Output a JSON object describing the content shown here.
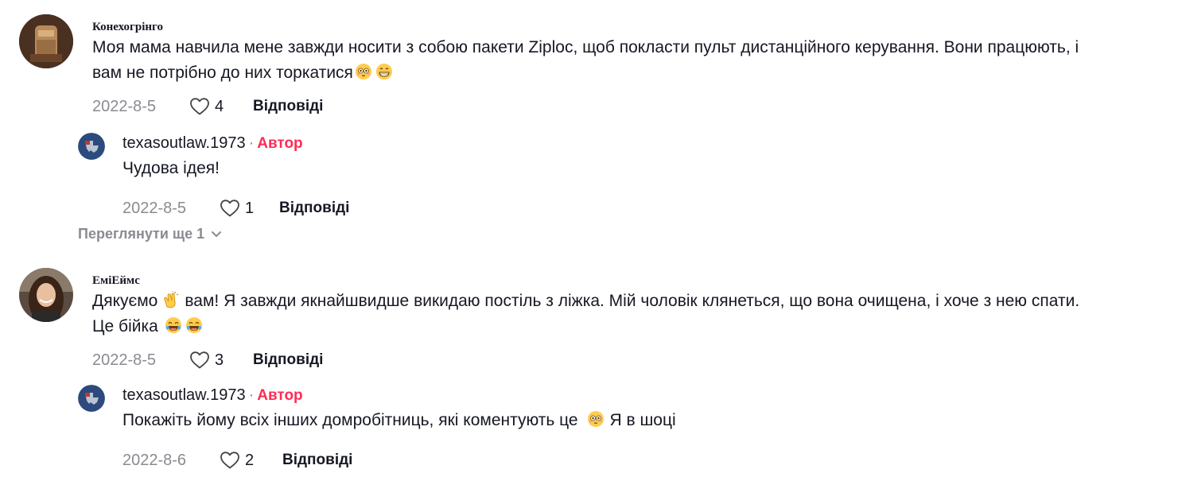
{
  "comments": [
    {
      "username": "Конехогрінго",
      "text_parts": [
        "Моя мама навчила мене завжди носити з собою пакети Ziploc, щоб покласти пульт дистанційного керування. Вони працюють, і",
        "вам не потрібно до них торкатися"
      ],
      "emojis": [
        "flushed-face-emoji",
        "grinning-face-emoji"
      ],
      "date": "2022-8-5",
      "likes": "4",
      "reply_label": "Відповіді",
      "reply": {
        "username": "texasoutlaw.1973",
        "separator": "·",
        "badge": "Автор",
        "text": "Чудова ідея!",
        "date": "2022-8-5",
        "likes": "1",
        "reply_label": "Відповіді"
      },
      "view_more": "Переглянути ще 1"
    },
    {
      "username": "ЕміЕймс",
      "text_parts": [
        "Дякуємо",
        "вам! Я завжди якнайшвидше викидаю постіль з ліжка. Мій чоловік клянеться, що вона очищена, і хоче з нею спати.",
        "Це бійка"
      ],
      "emojis": [
        "clapping-hands-emoji",
        "tears-of-joy-emoji"
      ],
      "date": "2022-8-5",
      "likes": "3",
      "reply_label": "Відповіді",
      "reply": {
        "username": "texasoutlaw.1973",
        "separator": "·",
        "badge": "Автор",
        "text_parts": [
          "Покажіть йому всіх інших домробітниць, які коментують це",
          "Я в шоці"
        ],
        "date": "2022-8-6",
        "likes": "2",
        "reply_label": "Відповіді"
      }
    }
  ],
  "colors": {
    "author_badge": "#fe2c55",
    "muted": "#8a8b91",
    "text": "#161823"
  },
  "icons": [
    "heart-outline-icon",
    "chevron-down-icon"
  ]
}
